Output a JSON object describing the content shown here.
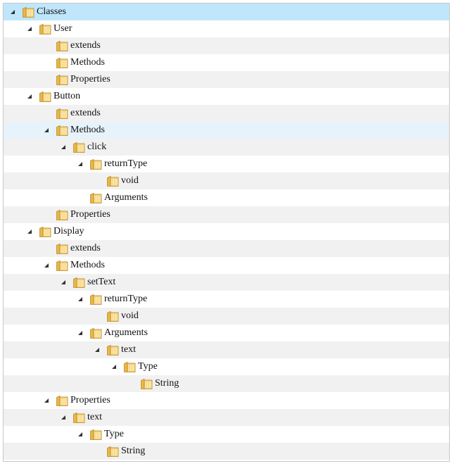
{
  "tree": {
    "icon": "folder-icon",
    "expand_icon": "expanded-triangle-icon",
    "colors": {
      "selected_row": "#bfe6fb",
      "hover_row": "#e6f3fa",
      "alt_row": "#f1f1f1",
      "border": "#c8c8c8",
      "folder_fill": "#f2c35a"
    },
    "rows": [
      {
        "label": "Classes",
        "depth": 0,
        "expanded": true,
        "state": "selected"
      },
      {
        "label": "User",
        "depth": 1,
        "expanded": true
      },
      {
        "label": "extends",
        "depth": 2
      },
      {
        "label": "Methods",
        "depth": 2
      },
      {
        "label": "Properties",
        "depth": 2
      },
      {
        "label": "Button",
        "depth": 1,
        "expanded": true
      },
      {
        "label": "extends",
        "depth": 2
      },
      {
        "label": "Methods",
        "depth": 2,
        "expanded": true,
        "state": "hover"
      },
      {
        "label": "click",
        "depth": 3,
        "expanded": true
      },
      {
        "label": "returnType",
        "depth": 4,
        "expanded": true
      },
      {
        "label": "void",
        "depth": 5
      },
      {
        "label": "Arguments",
        "depth": 4
      },
      {
        "label": "Properties",
        "depth": 2
      },
      {
        "label": "Display",
        "depth": 1,
        "expanded": true
      },
      {
        "label": "extends",
        "depth": 2
      },
      {
        "label": "Methods",
        "depth": 2,
        "expanded": true
      },
      {
        "label": "setText",
        "depth": 3,
        "expanded": true
      },
      {
        "label": "returnType",
        "depth": 4,
        "expanded": true
      },
      {
        "label": "void",
        "depth": 5
      },
      {
        "label": "Arguments",
        "depth": 4,
        "expanded": true
      },
      {
        "label": "text",
        "depth": 5,
        "expanded": true
      },
      {
        "label": "Type",
        "depth": 6,
        "expanded": true
      },
      {
        "label": "String",
        "depth": 7
      },
      {
        "label": "Properties",
        "depth": 2,
        "expanded": true
      },
      {
        "label": "text",
        "depth": 3,
        "expanded": true
      },
      {
        "label": "Type",
        "depth": 4,
        "expanded": true
      },
      {
        "label": "String",
        "depth": 5
      }
    ]
  }
}
